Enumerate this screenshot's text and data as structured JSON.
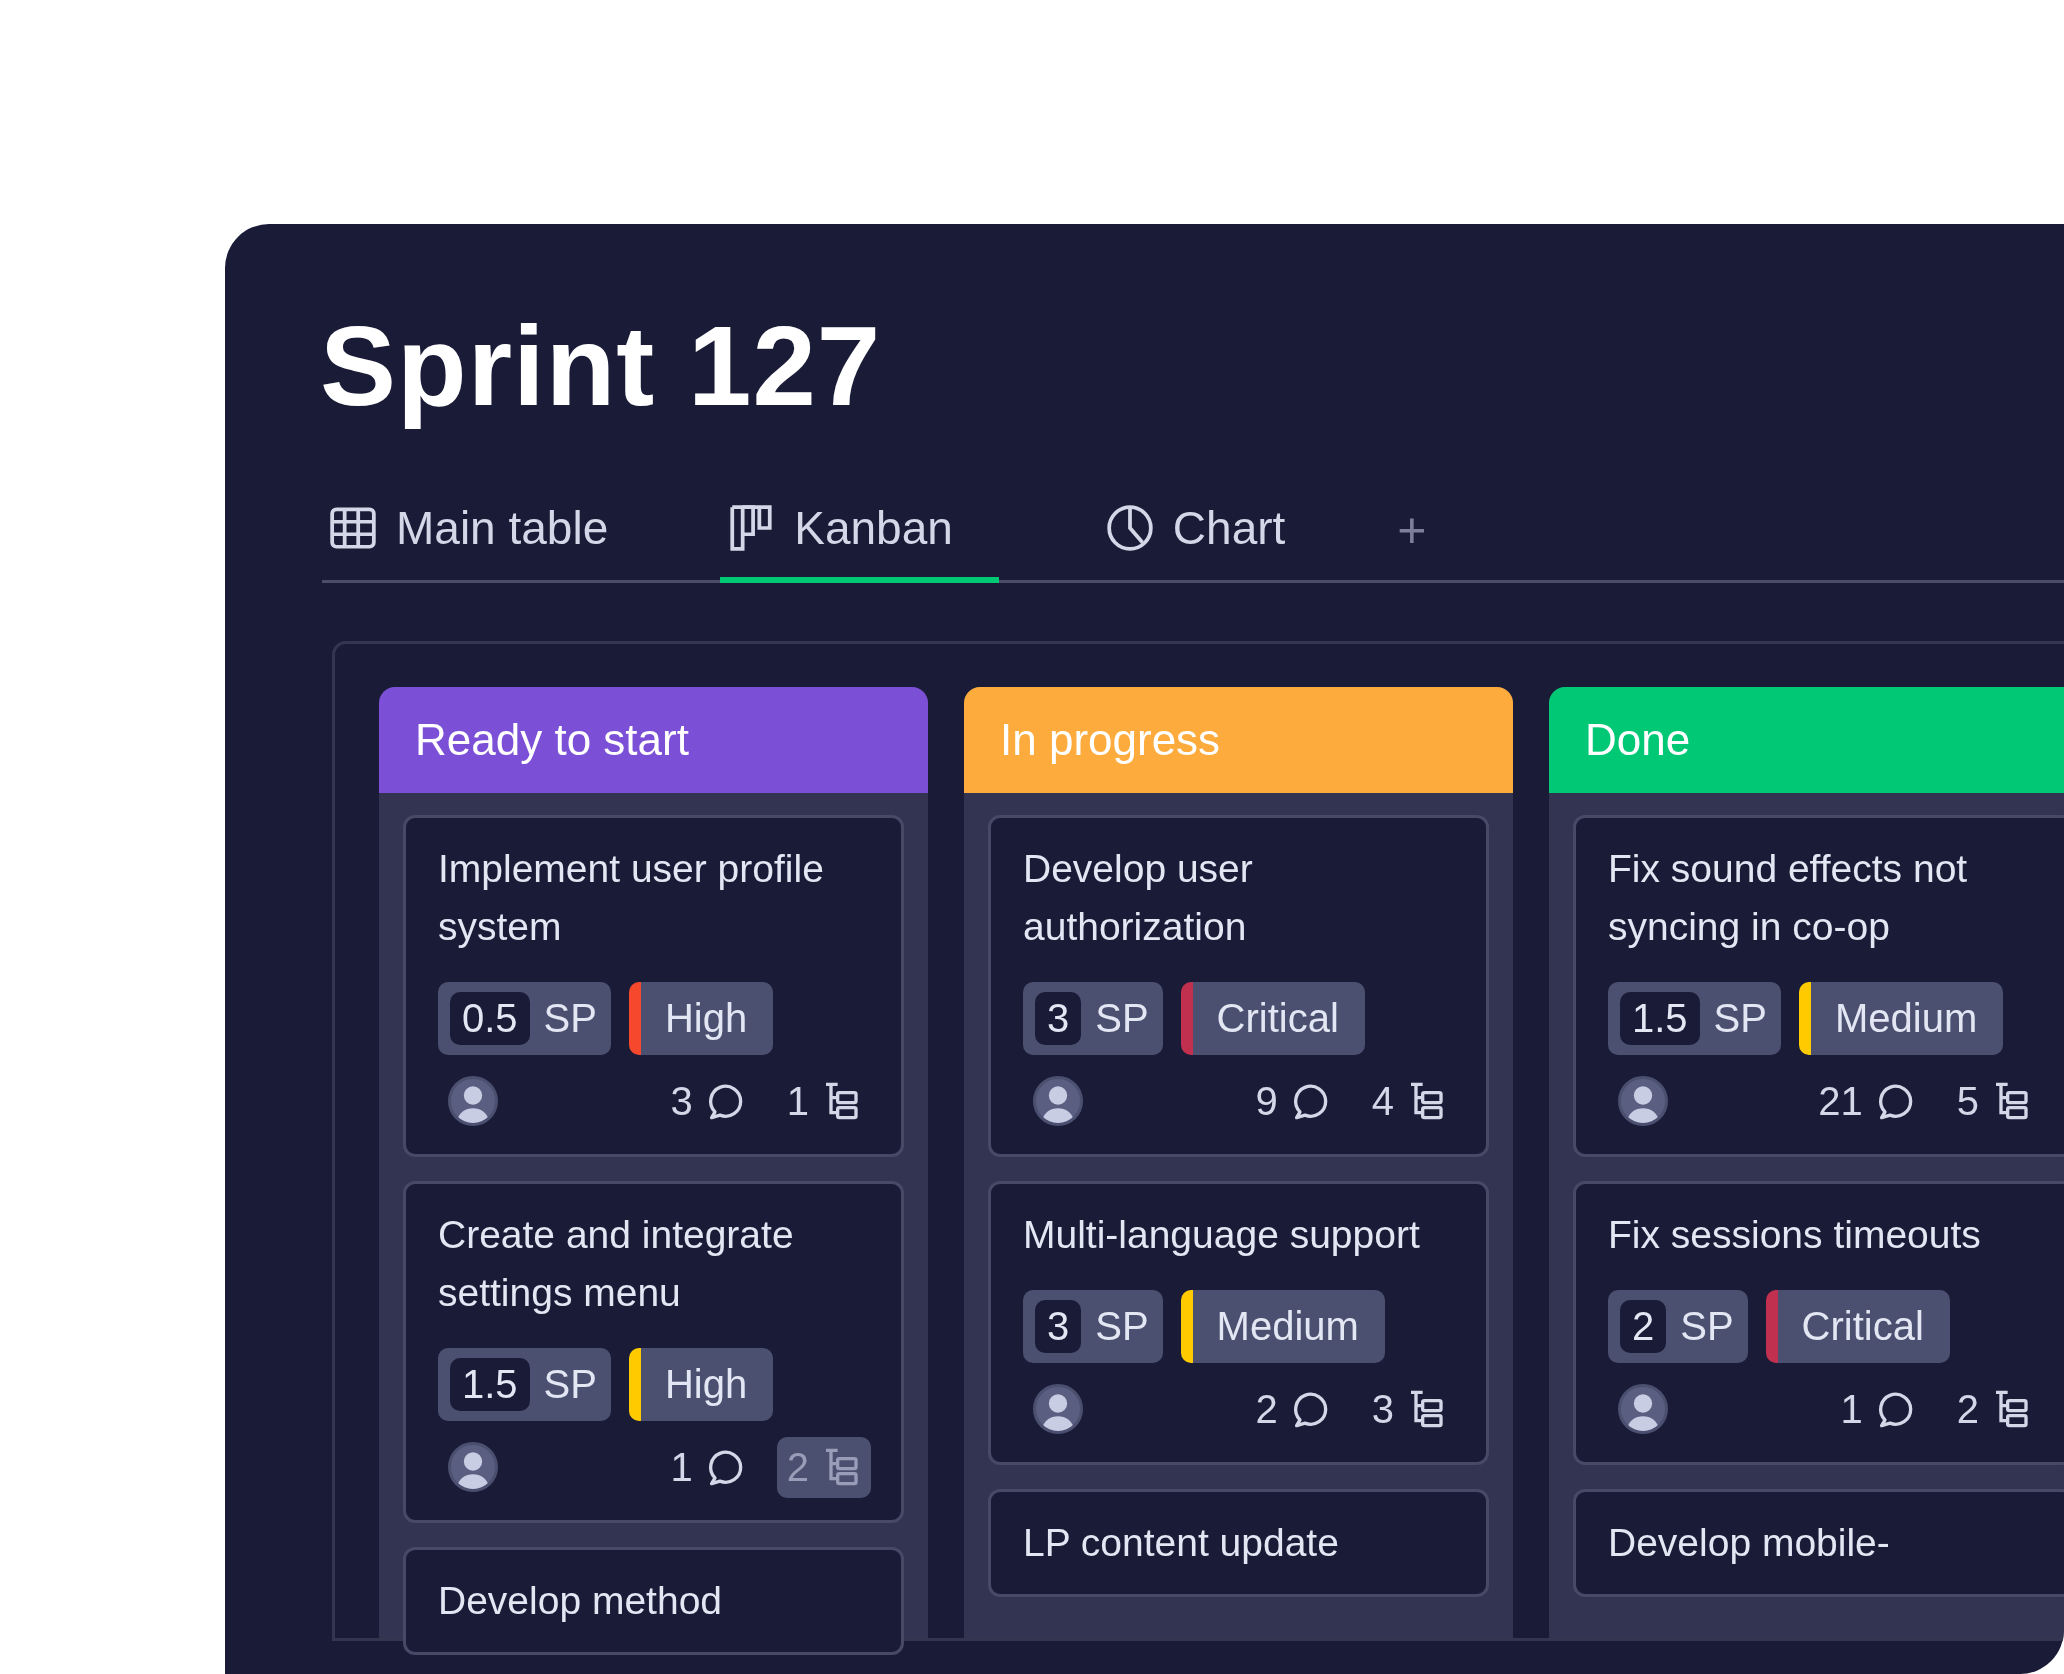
{
  "title": "Sprint 127",
  "tabs": [
    {
      "label": "Main table",
      "kind": "table",
      "selected": false
    },
    {
      "label": "Kanban",
      "kind": "kanban",
      "selected": true
    },
    {
      "label": "Chart",
      "kind": "chart",
      "selected": false
    }
  ],
  "add_tab": "+",
  "columns": [
    {
      "title": "Ready to start",
      "color": "#7b4fd6",
      "cards": [
        {
          "title": "Implement user profile system",
          "sp": "0.5",
          "sp_unit": "SP",
          "priority": {
            "label": "High",
            "color": "#f5482c"
          },
          "comments": "3",
          "subitems": "1",
          "subitems_highlighted": false
        },
        {
          "title": "Create and integrate settings menu",
          "sp": "1.5",
          "sp_unit": "SP",
          "priority": {
            "label": "High",
            "color": "#ffcb00"
          },
          "comments": "1",
          "subitems": "2",
          "subitems_highlighted": true
        },
        {
          "title": "Develop method"
        }
      ]
    },
    {
      "title": "In progress",
      "color": "#fdab3d",
      "cards": [
        {
          "title": "Develop user authorization",
          "sp": "3",
          "sp_unit": "SP",
          "priority": {
            "label": "Critical",
            "color": "#c1304f"
          },
          "comments": "9",
          "subitems": "4",
          "subitems_highlighted": false
        },
        {
          "title": "Multi-language support",
          "sp": "3",
          "sp_unit": "SP",
          "priority": {
            "label": "Medium",
            "color": "#ffcb00"
          },
          "comments": "2",
          "subitems": "3",
          "subitems_highlighted": false
        },
        {
          "title": "LP content update"
        }
      ]
    },
    {
      "title": "Done",
      "color": "#00c875",
      "cards": [
        {
          "title": "Fix sound effects not syncing in co-op",
          "sp": "1.5",
          "sp_unit": "SP",
          "priority": {
            "label": "Medium",
            "color": "#ffcb00"
          },
          "comments": "21",
          "subitems": "5",
          "subitems_highlighted": false
        },
        {
          "title": "Fix sessions timeouts",
          "sp": "2",
          "sp_unit": "SP",
          "priority": {
            "label": "Critical",
            "color": "#c1304f"
          },
          "comments": "1",
          "subitems": "2",
          "subitems_highlighted": false
        },
        {
          "title": "Develop mobile-"
        }
      ]
    }
  ]
}
